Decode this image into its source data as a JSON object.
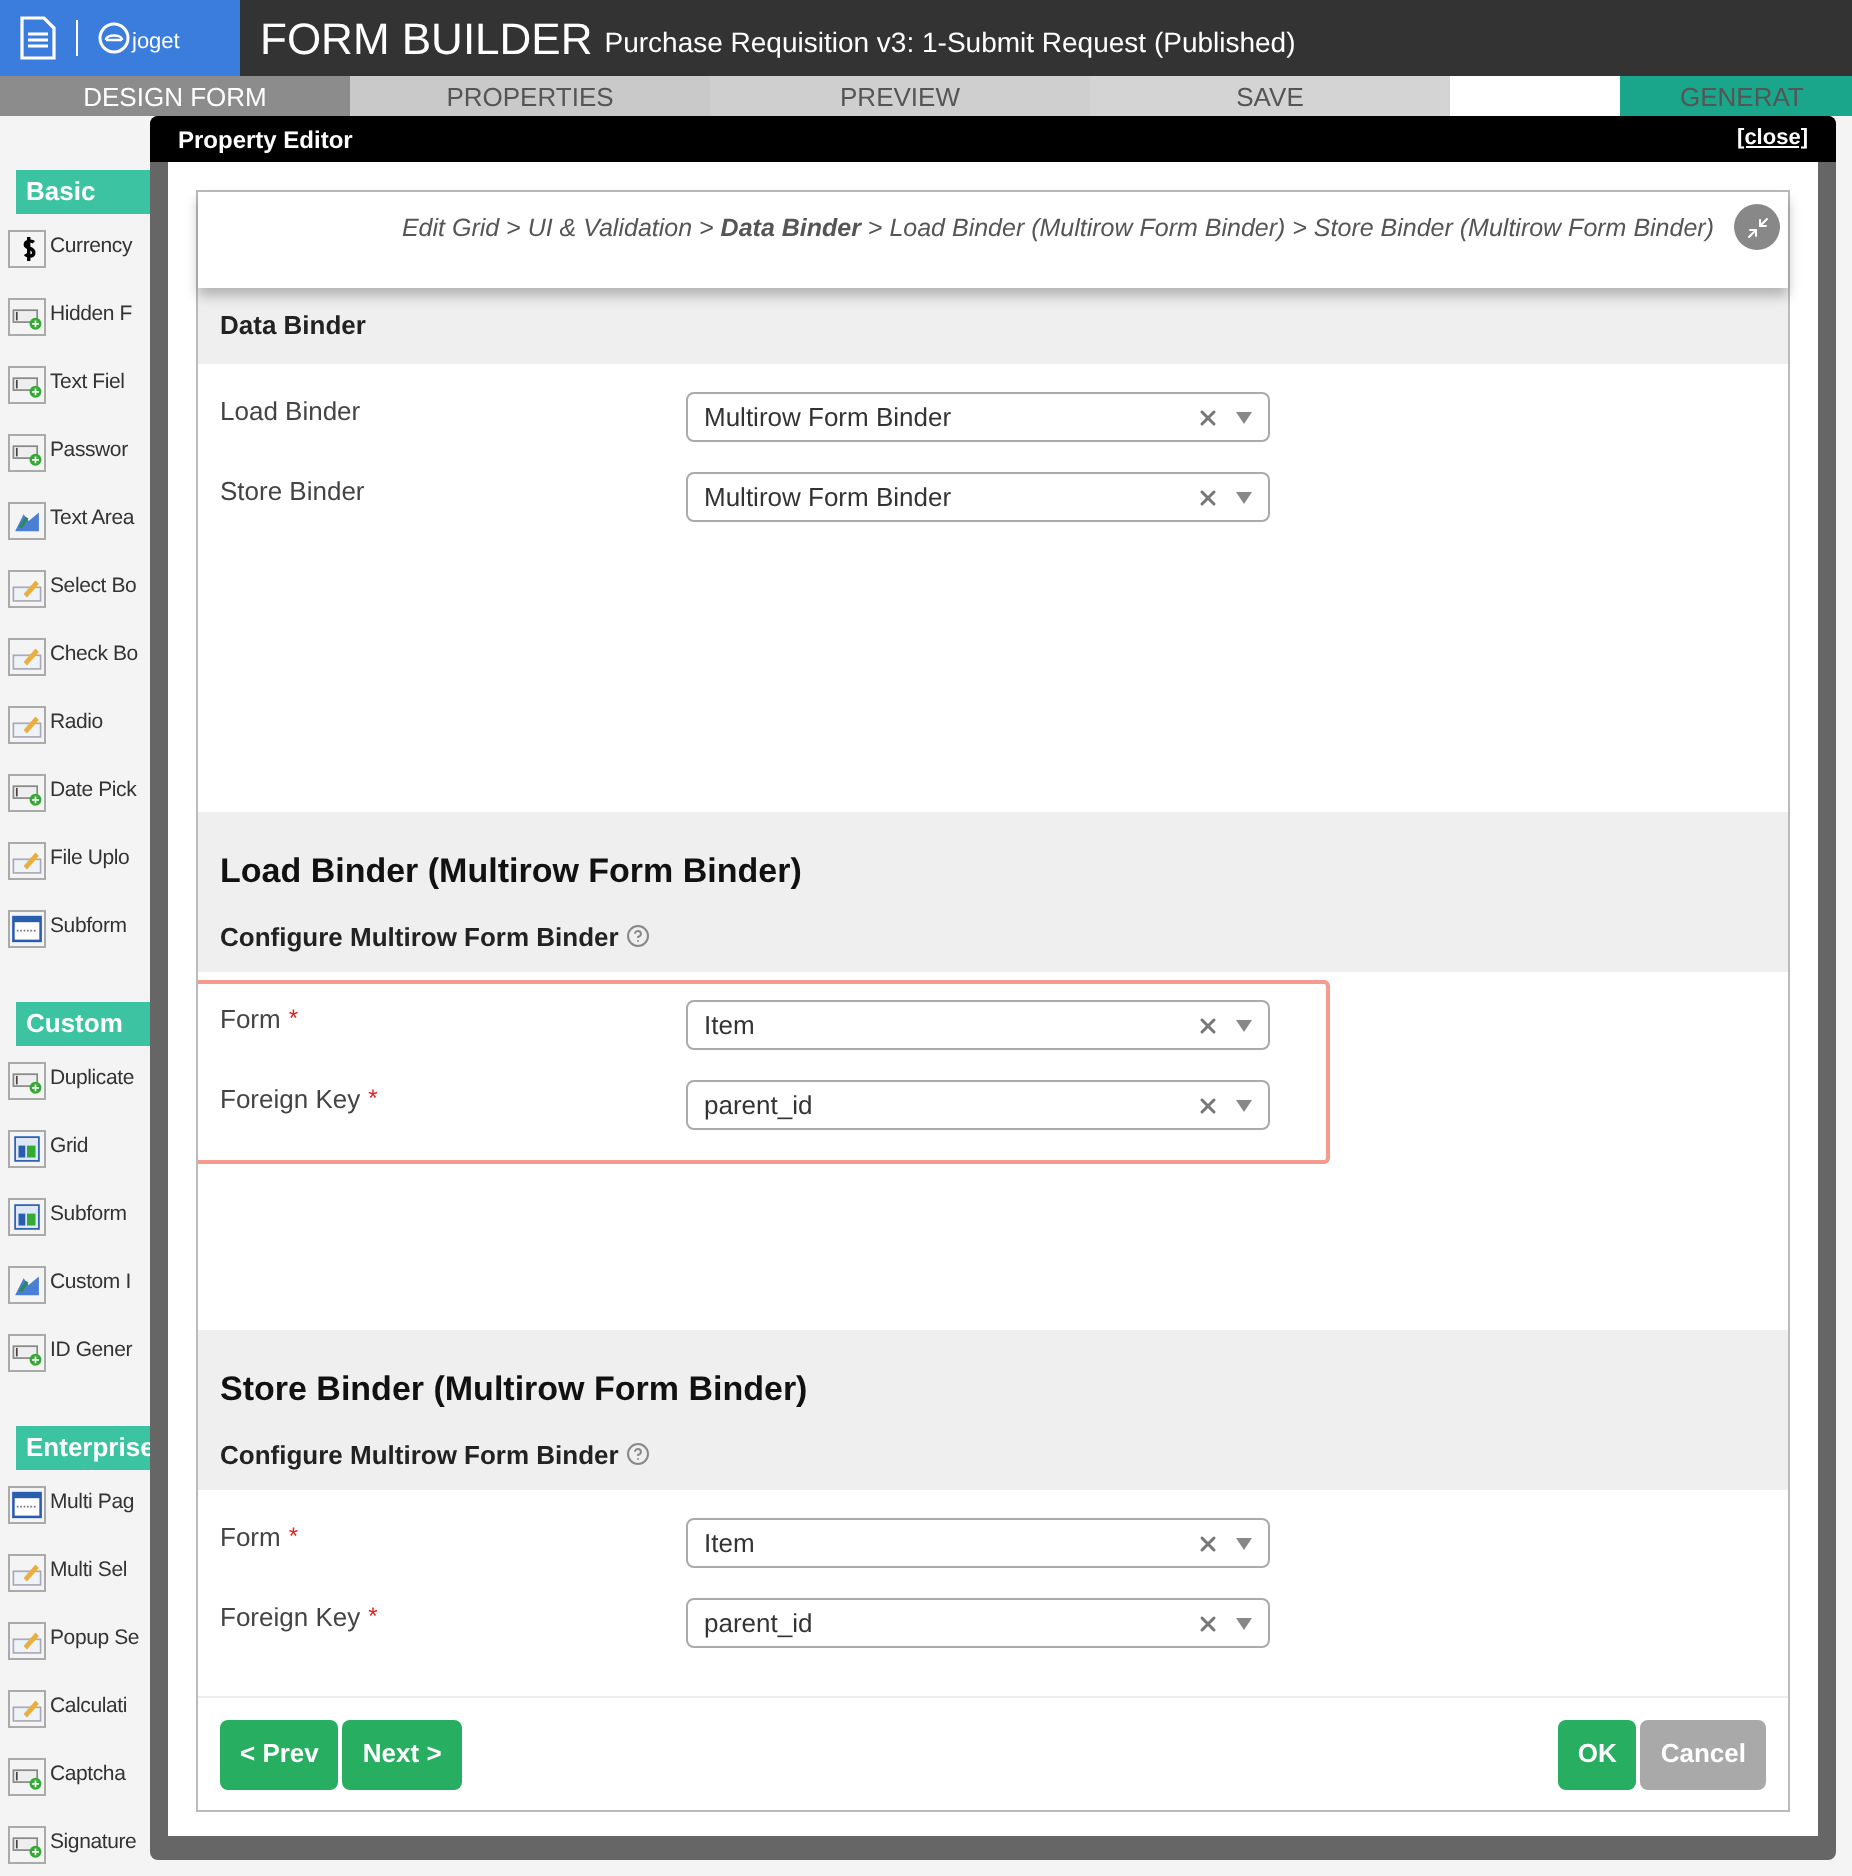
{
  "header": {
    "logo_text": "joget",
    "title": "FORM BUILDER",
    "subtitle": "Purchase Requisition v3: 1-Submit Request (Published)"
  },
  "tabs": [
    {
      "label": "DESIGN FORM",
      "selected": true,
      "kind": "step"
    },
    {
      "label": "PROPERTIES",
      "selected": false,
      "kind": "step"
    },
    {
      "label": "PREVIEW",
      "selected": false,
      "kind": "step"
    },
    {
      "label": "SAVE",
      "selected": false,
      "kind": "step"
    },
    {
      "label": "GENERAT",
      "selected": false,
      "kind": "action"
    }
  ],
  "palette": [
    {
      "title": "Basic",
      "items": [
        {
          "label": "Currency",
          "kind": "currency"
        },
        {
          "label": "Hidden F",
          "kind": "field"
        },
        {
          "label": "Text Fiel",
          "kind": "field"
        },
        {
          "label": "Passwor",
          "kind": "field"
        },
        {
          "label": "Text Area",
          "kind": "textarea"
        },
        {
          "label": "Select Bo",
          "kind": "pencil"
        },
        {
          "label": "Check Bo",
          "kind": "pencil"
        },
        {
          "label": "Radio",
          "kind": "pencil"
        },
        {
          "label": "Date Pick",
          "kind": "field"
        },
        {
          "label": "File Uplo",
          "kind": "pencil"
        },
        {
          "label": "Subform",
          "kind": "page"
        }
      ]
    },
    {
      "title": "Custom",
      "items": [
        {
          "label": "Duplicate",
          "kind": "field"
        },
        {
          "label": "Grid",
          "kind": "grid"
        },
        {
          "label": "Subform",
          "kind": "grid"
        },
        {
          "label": "Custom I",
          "kind": "textarea"
        },
        {
          "label": "ID Gener",
          "kind": "field"
        }
      ]
    },
    {
      "title": "Enterprise",
      "items": [
        {
          "label": "Multi Pag",
          "kind": "page"
        },
        {
          "label": "Multi Sel",
          "kind": "pencil"
        },
        {
          "label": "Popup Se",
          "kind": "pencil"
        },
        {
          "label": "Calculati",
          "kind": "pencil"
        },
        {
          "label": "Captcha",
          "kind": "field"
        },
        {
          "label": "Signature",
          "kind": "field"
        }
      ]
    }
  ],
  "dialog": {
    "title": "Property Editor",
    "close_label": "[close]",
    "breadcrumb": "Edit Grid > UI & Validation > **Data Binder** > Load Binder (Multirow Form Binder) > Store Binder (Multirow Form Binder)",
    "sections": [
      {
        "title": "Data Binder",
        "kind": "page",
        "highlighted": false,
        "fields": [
          {
            "label": "Load Binder",
            "value": "Multirow Form Binder"
          },
          {
            "label": "Store Binder",
            "value": "Multirow Form Binder"
          }
        ]
      },
      {
        "title": "Load Binder (Multirow Form Binder)",
        "kind": "sub",
        "subtitle": "Configure Multirow Form Binder",
        "highlighted": true,
        "fields": [
          {
            "label": "Form",
            "required_mark": "*",
            "value": "Item"
          },
          {
            "label": "Foreign Key",
            "required_mark": "*",
            "value": "parent_id"
          }
        ]
      },
      {
        "title": "Store Binder (Multirow Form Binder)",
        "kind": "sub",
        "subtitle": "Configure Multirow Form Binder",
        "highlighted": false,
        "fields": [
          {
            "label": "Form",
            "required_mark": "*",
            "value": "Item"
          },
          {
            "label": "Foreign Key",
            "required_mark": "*",
            "value": "parent_id"
          }
        ]
      }
    ],
    "left_buttons": [
      {
        "label": "< Prev",
        "disabled": false
      },
      {
        "label": "Next >",
        "disabled": false
      }
    ],
    "right_buttons": [
      {
        "label": "OK",
        "disabled": false
      },
      {
        "label": "Cancel",
        "disabled": true
      }
    ]
  }
}
